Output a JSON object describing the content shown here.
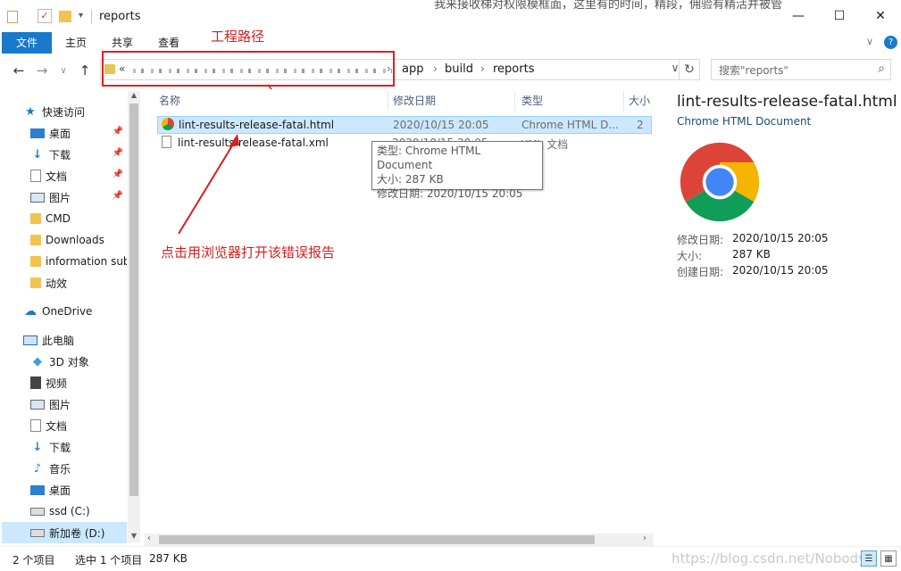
{
  "window": {
    "title": "reports",
    "background_bleed_text": "我来接收梯对权限模框面，这里有的时间，精段，佣验有精活并被管",
    "minimize_icon": "minimize-icon",
    "maximize_icon": "maximize-icon",
    "close_icon": "close-icon"
  },
  "ribbon": {
    "tabs": [
      "文件",
      "主页",
      "共享",
      "查看"
    ],
    "accent": "#1979ca"
  },
  "address": {
    "more": "«",
    "breadcrumbs": [
      "app",
      "build",
      "reports"
    ],
    "search_placeholder": "搜索\"reports\""
  },
  "annotations": {
    "path_label": "工程路径",
    "click_label": "点击用浏览器打开该错误报告",
    "color": "#d42020"
  },
  "sidebar": {
    "quick_access": "快速访问",
    "quick_items": [
      "桌面",
      "下载",
      "文档",
      "图片",
      "CMD",
      "Downloads",
      "information sub",
      "动效"
    ],
    "onedrive": "OneDrive",
    "this_pc": "此电脑",
    "pc_items": [
      "3D 对象",
      "视频",
      "图片",
      "文档",
      "下载",
      "音乐",
      "桌面",
      "ssd (C:)",
      "新加卷 (D:)"
    ]
  },
  "filelist": {
    "columns": [
      "名称",
      "修改日期",
      "类型",
      "大小"
    ],
    "rows": [
      {
        "name": "lint-results-release-fatal.html",
        "date": "2020/10/15 20:05",
        "type": "Chrome HTML D...",
        "size": "2"
      },
      {
        "name": "lint-results-release-fatal.xml",
        "date": "2020/10/15 20:05",
        "type": "XML 文档",
        "size": ""
      }
    ]
  },
  "tooltip": {
    "type": "类型: Chrome HTML Document",
    "size": "大小: 287 KB",
    "date": "修改日期: 2020/10/15 20:05"
  },
  "preview": {
    "filename": "lint-results-release-fatal.html",
    "filetype": "Chrome HTML Document",
    "modified_label": "修改日期:",
    "modified": "2020/10/15 20:05",
    "size_label": "大小:",
    "size": "287 KB",
    "created_label": "创建日期:",
    "created": "2020/10/15 20:05"
  },
  "status": {
    "count": "2 个项目",
    "selected": "选中 1 个项目",
    "size": "287 KB",
    "watermark": "https://blog.csdn.net/Nobody_"
  }
}
